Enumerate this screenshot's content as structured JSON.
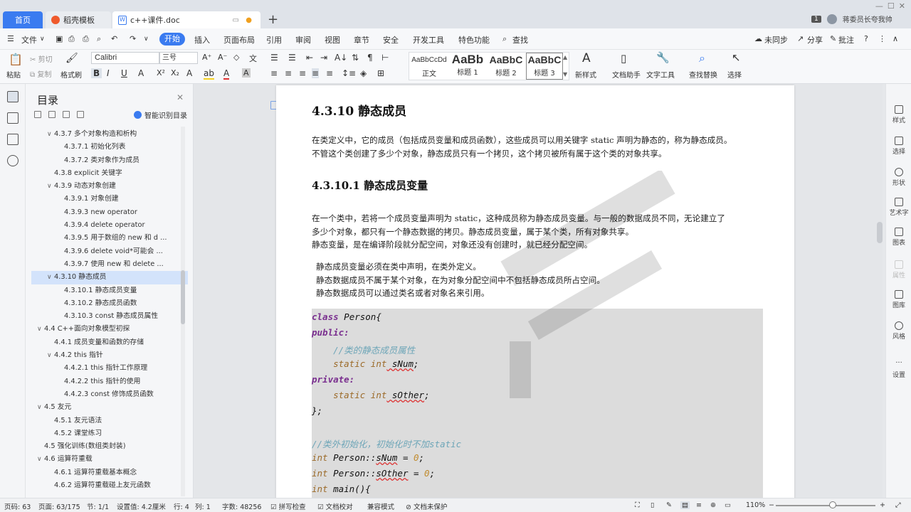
{
  "tabs": {
    "home": "首页",
    "template": "稻壳模板",
    "document": "c++课件.doc"
  },
  "titlebar": {
    "count_badge": "1",
    "user": "蒋委员长夸我帅"
  },
  "menu": {
    "file": "文件",
    "items": [
      "开始",
      "插入",
      "页面布局",
      "引用",
      "审阅",
      "视图",
      "章节",
      "安全",
      "开发工具",
      "特色功能"
    ],
    "search": "查找",
    "sync": "未同步",
    "share": "分享",
    "comment": "批注"
  },
  "ribbon": {
    "paste": "粘贴",
    "cut": "剪切",
    "copy": "复制",
    "format_painter": "格式刷",
    "font": "Calibri",
    "size": "三号",
    "styles": [
      {
        "sample": "AaBbCcDd",
        "name": "正文"
      },
      {
        "sample": "AaBb",
        "name": "标题 1"
      },
      {
        "sample": "AaBbC",
        "name": "标题 2"
      },
      {
        "sample": "AaBbC",
        "name": "标题 3"
      }
    ],
    "new_style": "新样式",
    "doc_helper": "文档助手",
    "text_tools": "文字工具",
    "find_replace": "查找替换",
    "select": "选择"
  },
  "toc": {
    "title": "目录",
    "smart": "智能识别目录",
    "items": [
      {
        "text": "4.3.7  多个对象构造和析构",
        "level": 2,
        "caret": "∨"
      },
      {
        "text": "4.3.7.1  初始化列表",
        "level": 3,
        "caret": ""
      },
      {
        "text": "4.3.7.2  类对象作为成员",
        "level": 3,
        "caret": ""
      },
      {
        "text": "4.3.8 explicit 关键字",
        "level": 2,
        "caret": ""
      },
      {
        "text": "4.3.9  动态对象创建",
        "level": 2,
        "caret": "∨"
      },
      {
        "text": "4.3.9.1  对象创建",
        "level": 3,
        "caret": ""
      },
      {
        "text": "4.3.9.3 new operator",
        "level": 3,
        "caret": ""
      },
      {
        "text": "4.3.9.4 delete operator",
        "level": 3,
        "caret": ""
      },
      {
        "text": "4.3.9.5  用于数组的 new 和 d ...",
        "level": 3,
        "caret": ""
      },
      {
        "text": "4.3.9.6 delete void*可能会 ...",
        "level": 3,
        "caret": ""
      },
      {
        "text": "4.3.9.7  使用 new 和 delete ...",
        "level": 3,
        "caret": ""
      },
      {
        "text": "4.3.10  静态成员",
        "level": 2,
        "caret": "∨",
        "active": true
      },
      {
        "text": "4.3.10.1  静态成员变量",
        "level": 3,
        "caret": ""
      },
      {
        "text": "4.3.10.2  静态成员函数",
        "level": 3,
        "caret": ""
      },
      {
        "text": "4.3.10.3 const 静态成员属性",
        "level": 3,
        "caret": ""
      },
      {
        "text": "4.4 C++面向对象模型初探",
        "level": 1,
        "caret": "∨"
      },
      {
        "text": "4.4.1  成员变量和函数的存储",
        "level": 2,
        "caret": ""
      },
      {
        "text": "4.4.2 this 指针",
        "level": 2,
        "caret": "∨"
      },
      {
        "text": "4.4.2.1 this 指针工作原理",
        "level": 3,
        "caret": ""
      },
      {
        "text": "4.4.2.2 this 指针的使用",
        "level": 3,
        "caret": ""
      },
      {
        "text": "4.4.2.3 const 修饰成员函数",
        "level": 3,
        "caret": ""
      },
      {
        "text": "4.5  友元",
        "level": 1,
        "caret": "∨"
      },
      {
        "text": "4.5.1  友元语法",
        "level": 2,
        "caret": ""
      },
      {
        "text": "4.5.2  课堂练习",
        "level": 2,
        "caret": ""
      },
      {
        "text": "4.5  强化训练(数组类封装)",
        "level": 1,
        "caret": ""
      },
      {
        "text": "4.6  运算符重载",
        "level": 1,
        "caret": "∨"
      },
      {
        "text": "4.6.1  运算符重载基本概念",
        "level": 2,
        "caret": ""
      },
      {
        "text": "4.6.2  运算符重载碰上友元函数",
        "level": 2,
        "caret": ""
      }
    ]
  },
  "doc": {
    "h3": "4.3.10  静态成员",
    "p1a": "在类定义中，它的成员（包括成员变量和成员函数），这些成员可以用关键字 static 声明为静态的，称为静态成员。",
    "p1b": "不管这个类创建了多少个对象，静态成员只有一个拷贝，这个拷贝被所有属于这个类的对象共享。",
    "h4": "4.3.10.1  静态成员变量",
    "p2a": "在一个类中，若将一个成员变量声明为 static，这种成员称为静态成员变量。与一般的数据成员不同，无论建立了",
    "p2b": "多少个对象，都只有一个静态数据的拷贝。静态成员变量，属于某个类，所有对象共享。",
    "p2c": "静态变量，是在编译阶段就分配空间，对象还没有创建时，就已经分配空间。",
    "b1": "静态成员变量必须在类中声明，在类外定义。",
    "b2": "静态数据成员不属于某个对象，在为对象分配空间中不包括静态成员所占空间。",
    "b3": "静态数据成员可以通过类名或者对象名来引用。",
    "code": {
      "l1a": "class",
      "l1b": " Person{",
      "l2": "public:",
      "l3": "    //类的静态成员属性",
      "l4a": "    static",
      "l4b": " int",
      "l4c": " sNum",
      "l4d": ";",
      "l5": "private:",
      "l6a": "    static",
      "l6b": " int",
      "l6c": " sOther",
      "l6d": ";",
      "l7": "};",
      "l8": "//类外初始化，初始化时不加static",
      "l9a": "int",
      "l9b": " Person::",
      "l9c": "sNum",
      "l9d": " = ",
      "l9e": "0",
      "l9f": ";",
      "l10a": "int",
      "l10b": " Person::",
      "l10c": "sOther",
      "l10d": " = ",
      "l10e": "0",
      "l10f": ";",
      "l11a": "int",
      "l11b": " main(){"
    }
  },
  "rightpanel": [
    "样式",
    "选择",
    "形状",
    "艺术字",
    "图表",
    "图库",
    "风格",
    "设置"
  ],
  "rightpanel_disabled": "属性",
  "status": {
    "page_code": "页码: 63",
    "pages": "页面: 63/175",
    "section": "节: 1/1",
    "setting": "设置值: 4.2厘米",
    "row": "行: 4",
    "col": "列: 1",
    "words": "字数: 48256",
    "spell": "拼写检查",
    "proof": "文档校对",
    "compat": "兼容模式",
    "protect": "文档未保护",
    "zoom": "110%"
  }
}
